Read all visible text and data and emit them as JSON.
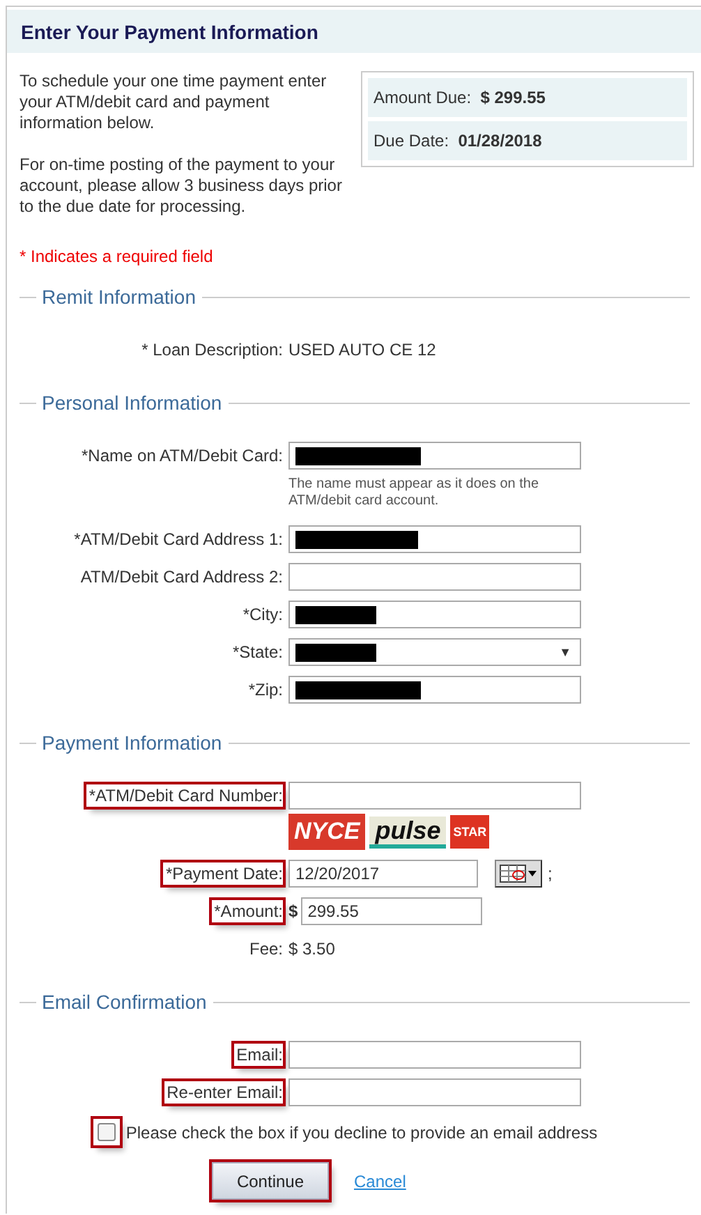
{
  "header": {
    "title": "Enter Your Payment Information"
  },
  "intro": [
    "To schedule your one time payment enter your ATM/debit card and payment information below.",
    "For on-time posting of the payment to your account, please allow 3 business days prior to the due date for processing."
  ],
  "summary": [
    {
      "label": "Amount Due:",
      "value": "$ 299.55"
    },
    {
      "label": "Due Date:",
      "value": "01/28/2018"
    }
  ],
  "required_note": "* Indicates a required field",
  "sections": [
    {
      "title": "Remit Information",
      "rows": [
        {
          "kind": "static",
          "label": "* Loan Description:",
          "value": "USED AUTO CE 12",
          "highlighted": false
        }
      ]
    },
    {
      "title": "Personal Information",
      "rows": [
        {
          "kind": "text",
          "label": "*Name on ATM/Debit Card:",
          "redacted": true,
          "highlighted": false,
          "hint": "The name must appear as it does on the ATM/debit card account."
        },
        {
          "kind": "text",
          "label": "*ATM/Debit Card Address 1:",
          "redacted": true,
          "highlighted": false
        },
        {
          "kind": "text",
          "label": "ATM/Debit Card Address 2:",
          "redacted": false,
          "highlighted": false
        },
        {
          "kind": "text",
          "label": "*City:",
          "redacted": true,
          "highlighted": false
        },
        {
          "kind": "select",
          "label": "*State:",
          "redacted": true,
          "highlighted": false,
          "caret": "▼"
        },
        {
          "kind": "text",
          "label": "*Zip:",
          "redacted": true,
          "highlighted": false
        }
      ]
    },
    {
      "title": "Payment Information",
      "rows": [
        {
          "kind": "text",
          "label": "*ATM/Debit Card Number:",
          "redacted": false,
          "highlighted": true
        },
        {
          "kind": "logos",
          "logos": [
            "NYCE",
            "pulse",
            "STAR"
          ]
        },
        {
          "kind": "date",
          "label": "*Payment Date:",
          "value": "12/20/2017",
          "suffix": ";",
          "highlighted": true
        },
        {
          "kind": "amount",
          "label": "*Amount:",
          "prefix": "$",
          "value": "299.55",
          "highlighted": true
        },
        {
          "kind": "static",
          "label": "Fee:",
          "value": "$ 3.50",
          "highlighted": false
        }
      ]
    },
    {
      "title": "Email Confirmation",
      "rows": [
        {
          "kind": "text",
          "label": "Email:",
          "redacted": false,
          "highlighted": true
        },
        {
          "kind": "text",
          "label": "Re-enter Email:",
          "redacted": false,
          "highlighted": true
        }
      ]
    }
  ],
  "decline": {
    "label": "Please check the box if you decline to provide an email address",
    "checked": false,
    "highlighted": true
  },
  "actions": {
    "continue": "Continue",
    "continue_highlighted": true,
    "cancel": "Cancel"
  }
}
